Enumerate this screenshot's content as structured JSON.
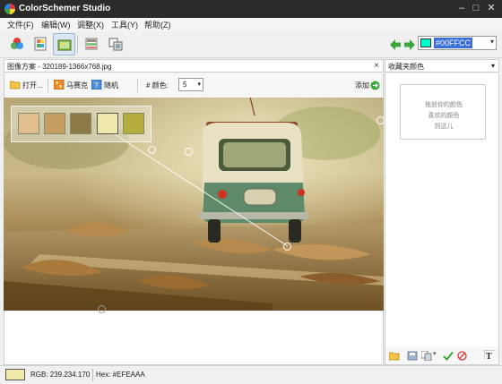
{
  "app": {
    "title": "ColorSchemer Studio",
    "minimize": "–",
    "maximize": "□",
    "close": "✕"
  },
  "menu": {
    "items": [
      "文件(F)",
      "编辑(W)",
      "调整(X)",
      "工具(Y)",
      "帮助(Z)"
    ]
  },
  "toolbar": {
    "buttons": [
      "color-wheel-icon",
      "palette-icon",
      "image-scheme-icon",
      "gallery-icon",
      "pattern-icon"
    ],
    "active_button": "image-scheme-icon",
    "current_color": "#00FFCC",
    "current_color_label": "#00FFCC"
  },
  "left_panel": {
    "header": "图像方案 - 320189-1366x768.jpg",
    "close": "×",
    "open_label": "打开...",
    "mosaic_label": "马赛克",
    "random_label": "随机",
    "colors_label": "# 颜色:",
    "colors_count": "5",
    "add_label": "添加"
  },
  "palette": {
    "colors": [
      "#E2C08E",
      "#C49E63",
      "#8C7A47",
      "#EFEAAA",
      "#B3AD3C"
    ]
  },
  "right_panel": {
    "header": "收藏夹颜色",
    "drop_lines": [
      "拖放你的颜色",
      "喜欢的颜色",
      "到这儿"
    ]
  },
  "status": {
    "swatch_color": "#EFEAAA",
    "rgb": "RGB: 239.234.170",
    "hex": "Hex: #EFEAAA"
  },
  "colors": {
    "titlebar": "#2B2B2B",
    "selection": "#3A6FD8",
    "green_arrow": "#3AA63A"
  }
}
